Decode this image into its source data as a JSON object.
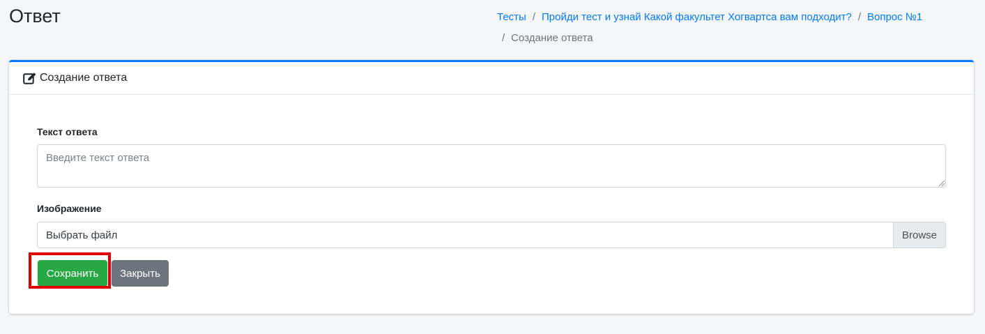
{
  "page": {
    "title": "Ответ"
  },
  "breadcrumb": {
    "items": [
      {
        "label": "Тесты",
        "link": true
      },
      {
        "label": "Пройди тест и узнай Какой факультет Хогвартса вам подходит?",
        "link": true
      },
      {
        "label": "Вопрос №1",
        "link": true
      },
      {
        "label": "Создание ответа",
        "link": false
      }
    ],
    "separator": "/"
  },
  "card": {
    "header_icon": "edit-icon",
    "title": "Создание ответа",
    "accent_color": "#007bff"
  },
  "form": {
    "answer_text": {
      "label": "Текст ответа",
      "placeholder": "Введите текст ответа",
      "value": ""
    },
    "image": {
      "label": "Изображение",
      "file_label": "Выбрать файл",
      "browse_label": "Browse"
    },
    "buttons": {
      "save_label": "Сохранить",
      "save_color": "#28a745",
      "close_label": "Закрыть",
      "close_color": "#6c757d"
    },
    "highlight_color": "#e00000"
  }
}
